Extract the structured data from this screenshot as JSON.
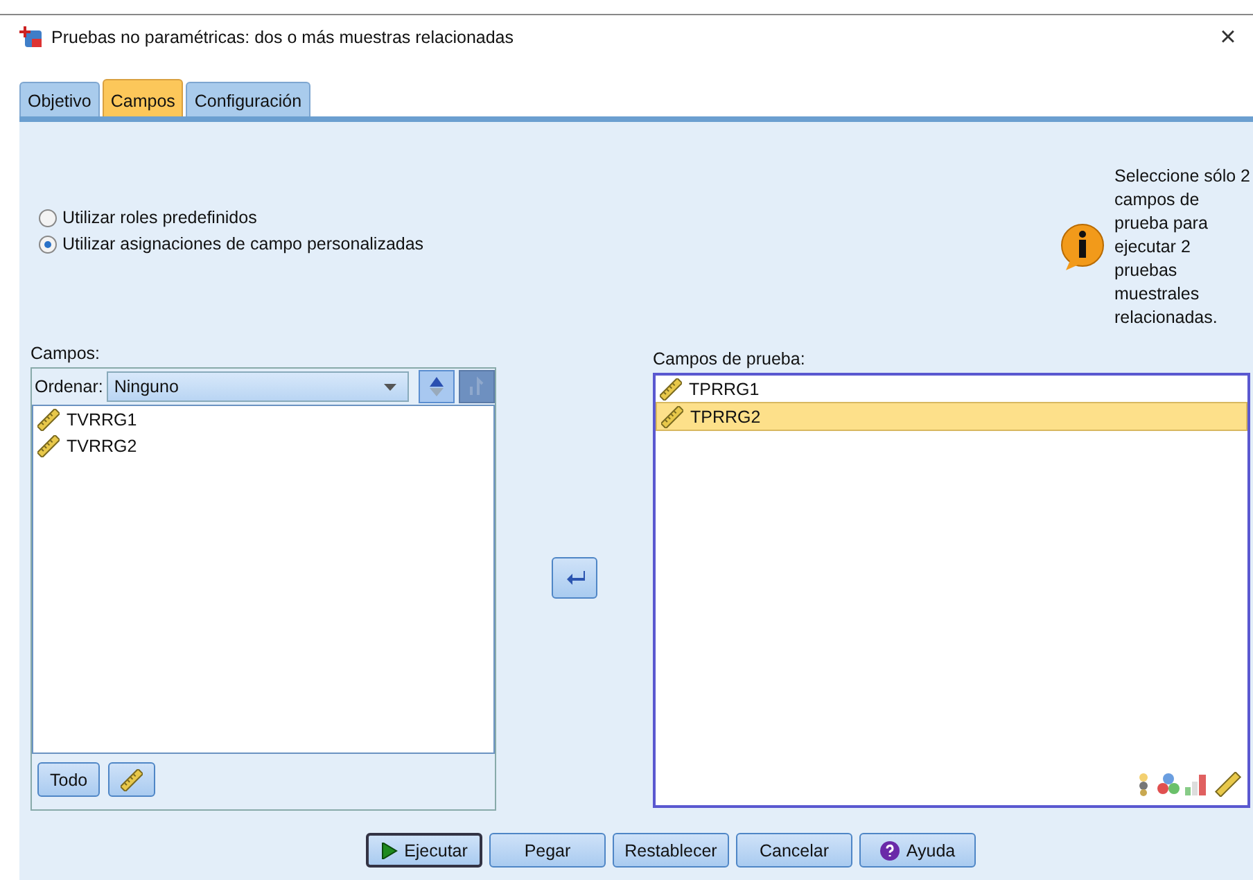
{
  "window": {
    "title": "Pruebas no paramétricas: dos o más muestras relacionadas",
    "close": "×"
  },
  "tabs": [
    {
      "label": "Objetivo",
      "selected": false
    },
    {
      "label": "Campos",
      "selected": true
    },
    {
      "label": "Configuración",
      "selected": false
    }
  ],
  "radios": [
    {
      "label": "Utilizar roles predefinidos",
      "selected": false
    },
    {
      "label": "Utilizar asignaciones de campo personalizadas",
      "selected": true
    }
  ],
  "info": {
    "text": "Seleccione sólo 2 campos de prueba para ejecutar 2 pruebas muestrales relacionadas."
  },
  "fields": {
    "label": "Campos:",
    "sort_label": "Ordenar:",
    "sort_value": "Ninguno",
    "items": [
      {
        "name": "TVRRG1",
        "selected": false
      },
      {
        "name": "TVRRG2",
        "selected": false
      }
    ],
    "all_button": "Todo"
  },
  "test_fields": {
    "label": "Campos de prueba:",
    "items": [
      {
        "name": "TPRRG1",
        "selected": false
      },
      {
        "name": "TPRRG2",
        "selected": true
      }
    ]
  },
  "buttons": [
    {
      "label": "Ejecutar",
      "kind": "run"
    },
    {
      "label": "Pegar",
      "kind": "plain"
    },
    {
      "label": "Restablecer",
      "kind": "plain"
    },
    {
      "label": "Cancelar",
      "kind": "plain"
    },
    {
      "label": "Ayuda",
      "kind": "help"
    }
  ]
}
